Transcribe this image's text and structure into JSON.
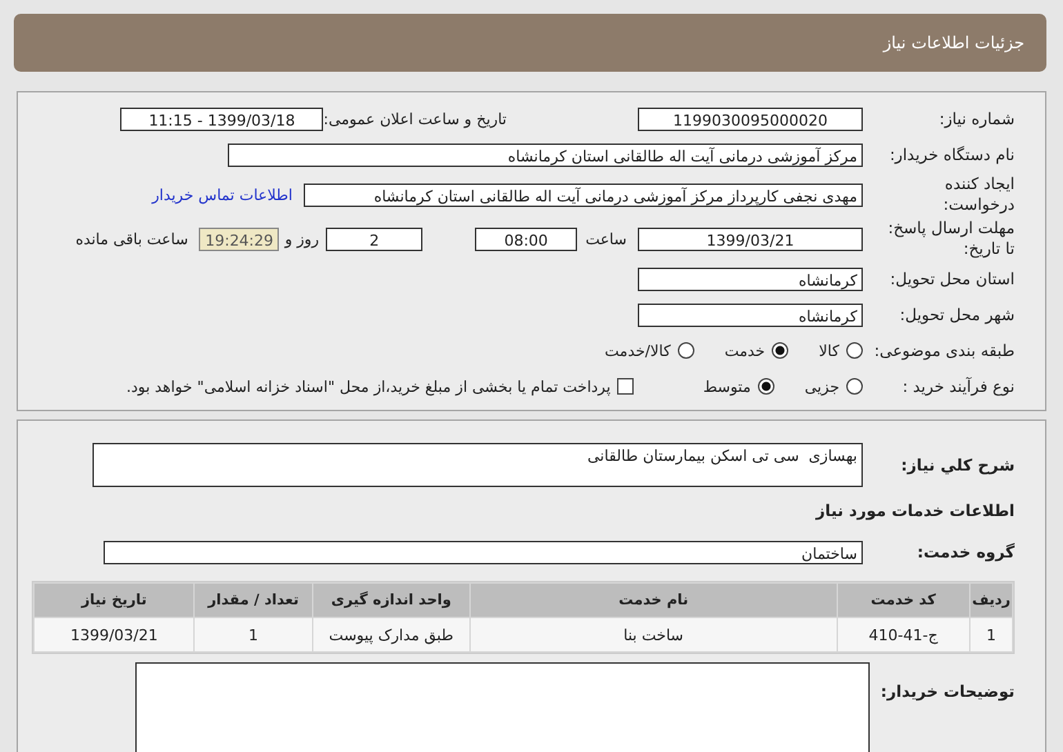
{
  "header": {
    "title": "جزئیات اطلاعات نیاز"
  },
  "need_number": {
    "label": "شماره نیاز:",
    "value": "1199030095000020"
  },
  "announce": {
    "label": "تاریخ و ساعت اعلان عمومی:",
    "value": "1399/03/18 - 11:15"
  },
  "buyer_org": {
    "label": "نام دستگاه خریدار:",
    "value": "مرکز آموزشی درمانی آیت اله طالقانی استان کرمانشاه"
  },
  "requester": {
    "label_lines": [
      "ایجاد کننده",
      "درخواست:"
    ],
    "value": "مهدی نجفی کارپرداز مرکز آموزشی درمانی آیت اله طالقانی استان کرمانشاه",
    "link": "اطلاعات تماس خریدار"
  },
  "deadline": {
    "label_lines": [
      "مهلت ارسال پاسخ:",
      "تا تاریخ:"
    ],
    "date": "1399/03/21",
    "time_label": "ساعت",
    "time": "08:00",
    "days": "2",
    "days_label": "روز و",
    "remaining": "19:24:29",
    "remaining_label": "ساعت باقی مانده"
  },
  "province": {
    "label": "استان محل تحویل:",
    "value": "کرمانشاه"
  },
  "city": {
    "label": "شهر محل تحویل:",
    "value": "کرمانشاه"
  },
  "category": {
    "label": "طبقه بندی موضوعی:",
    "options": [
      {
        "label": "کالا",
        "selected": false
      },
      {
        "label": "خدمت",
        "selected": true
      },
      {
        "label": "کالا/خدمت",
        "selected": false
      }
    ]
  },
  "process": {
    "label": "نوع فرآیند خرید :",
    "options": [
      {
        "label": "جزیی",
        "selected": false
      },
      {
        "label": "متوسط",
        "selected": true
      }
    ],
    "treasury": {
      "label": "پرداخت تمام یا بخشی از مبلغ خرید،از محل \"اسناد خزانه اسلامی\" خواهد بود.",
      "checked": false
    }
  },
  "description": {
    "label": "شرح کلي نياز:",
    "value": "بهسازی  سی تی اسکن بیمارستان طالقانی"
  },
  "services_title": "اطلاعات خدمات مورد نیاز",
  "service_group": {
    "label": "گروه خدمت:",
    "value": "ساختمان"
  },
  "table": {
    "columns": [
      "ردیف",
      "کد خدمت",
      "نام خدمت",
      "واحد اندازه گیری",
      "تعداد / مقدار",
      "تاریخ نیاز"
    ],
    "rows": [
      [
        "1",
        "ج-41-410",
        "ساخت بنا",
        "طبق مدارک پیوست",
        "1",
        "1399/03/21"
      ]
    ]
  },
  "buyer_notes": {
    "label": "توضیحات خریدار:"
  }
}
